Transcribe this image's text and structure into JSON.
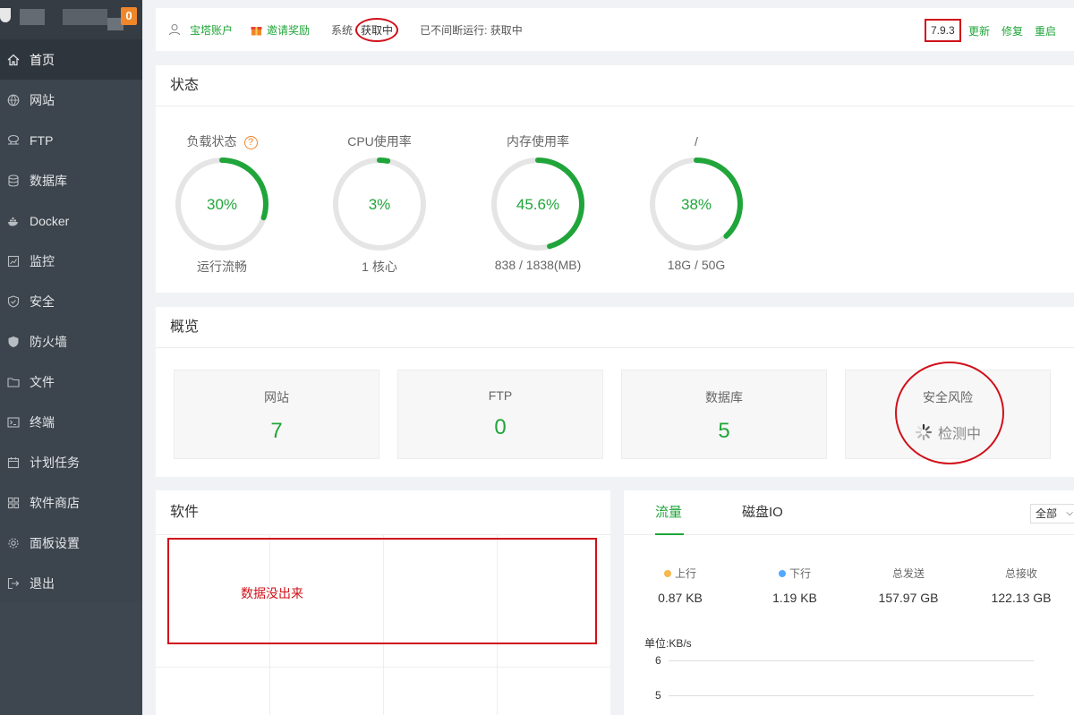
{
  "sidebar": {
    "badge": "0",
    "items": [
      {
        "label": "首页",
        "icon": "home-icon"
      },
      {
        "label": "网站",
        "icon": "globe-icon"
      },
      {
        "label": "FTP",
        "icon": "ftp-icon"
      },
      {
        "label": "数据库",
        "icon": "database-icon"
      },
      {
        "label": "Docker",
        "icon": "docker-icon"
      },
      {
        "label": "监控",
        "icon": "monitor-icon"
      },
      {
        "label": "安全",
        "icon": "shield-icon"
      },
      {
        "label": "防火墙",
        "icon": "firewall-icon"
      },
      {
        "label": "文件",
        "icon": "folder-icon"
      },
      {
        "label": "终端",
        "icon": "terminal-icon"
      },
      {
        "label": "计划任务",
        "icon": "calendar-icon"
      },
      {
        "label": "软件商店",
        "icon": "grid-icon"
      },
      {
        "label": "面板设置",
        "icon": "gear-icon"
      },
      {
        "label": "退出",
        "icon": "logout-icon"
      }
    ]
  },
  "topbar": {
    "account": "宝塔账户",
    "invite": "邀请奖励",
    "system_label": "系统",
    "system_value": "获取中",
    "uptime": "已不间断运行: 获取中",
    "version": "7.9.3",
    "update": "更新",
    "repair": "修复",
    "restart": "重启"
  },
  "status": {
    "title": "状态",
    "gauges": [
      {
        "title": "负载状态",
        "value": "30%",
        "percent": 30,
        "sub": "运行流畅",
        "help": "?"
      },
      {
        "title": "CPU使用率",
        "value": "3%",
        "percent": 3,
        "sub": "1 核心"
      },
      {
        "title": "内存使用率",
        "value": "45.6%",
        "percent": 45.6,
        "sub": "838 / 1838(MB)"
      },
      {
        "title": "/",
        "value": "38%",
        "percent": 38,
        "sub": "18G / 50G"
      }
    ]
  },
  "overview": {
    "title": "概览",
    "boxes": [
      {
        "label": "网站",
        "value": "7"
      },
      {
        "label": "FTP",
        "value": "0"
      },
      {
        "label": "数据库",
        "value": "5"
      },
      {
        "label": "安全风险",
        "value": "检测中"
      }
    ]
  },
  "software": {
    "title": "软件",
    "note": "数据没出来"
  },
  "traffic": {
    "tabs": [
      "流量",
      "磁盘IO"
    ],
    "select": "全部",
    "stats": [
      {
        "label": "上行",
        "value": "0.87 KB",
        "dot_color": "#f7b94b"
      },
      {
        "label": "下行",
        "value": "1.19 KB",
        "dot_color": "#52a9ff"
      },
      {
        "label": "总发送",
        "value": "157.97 GB"
      },
      {
        "label": "总接收",
        "value": "122.13 GB"
      }
    ],
    "unit": "单位:KB/s",
    "yticks": [
      "6",
      "5"
    ]
  },
  "colors": {
    "accent": "#20a53a",
    "track": "#e5e5e5",
    "annotation": "#d0101a"
  }
}
